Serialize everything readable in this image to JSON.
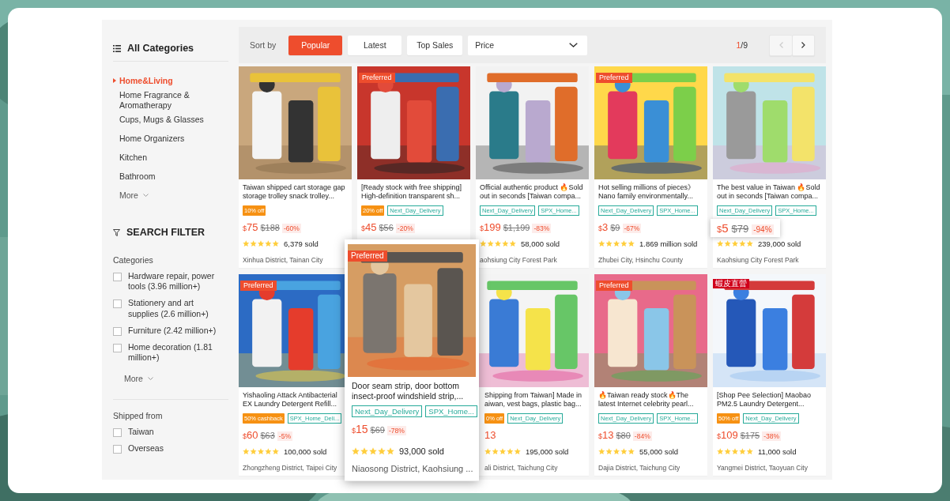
{
  "sidebar": {
    "title": "All Categories",
    "categories": [
      {
        "label": "Home&Living",
        "selected": true
      },
      {
        "label": "Home Fragrance & Aromatherapy",
        "selected": false
      },
      {
        "label": "Cups, Mugs & Glasses",
        "selected": false
      },
      {
        "label": "Home Organizers",
        "selected": false
      },
      {
        "label": "Kitchen",
        "selected": false
      },
      {
        "label": "Bathroom",
        "selected": false
      }
    ],
    "categories_more": "More",
    "filter_title": "SEARCH FILTER",
    "filter_groups": [
      {
        "title": "Categories",
        "options": [
          {
            "label": "Hardware repair, power tools (3.96 million+)",
            "checked": false
          },
          {
            "label": "Stationery and art supplies (2.6 million+)",
            "checked": false
          },
          {
            "label": "Furniture (2.42 million+)",
            "checked": false
          },
          {
            "label": "Home decoration (1.81 million+)",
            "checked": false
          }
        ],
        "more": "More"
      },
      {
        "title": "Shipped from",
        "options": [
          {
            "label": "Taiwan",
            "checked": false
          },
          {
            "label": "Overseas",
            "checked": false
          }
        ]
      }
    ]
  },
  "sort_bar": {
    "label": "Sort by",
    "options": [
      {
        "label": "Popular",
        "selected": true
      },
      {
        "label": "Latest",
        "selected": false
      },
      {
        "label": "Top Sales",
        "selected": false
      }
    ],
    "price_dropdown": "Price",
    "page_current": "1",
    "page_total": "/9",
    "prev_disabled": true
  },
  "products": [
    {
      "title": "Taiwan shipped cart storage gap storage trolley snack trolley...",
      "labels": [
        {
          "kind": "promo",
          "text": "10% off"
        }
      ],
      "price": {
        "currency": "$",
        "amount": "75",
        "original": "$188",
        "discount": "-60%"
      },
      "stars": 5,
      "sold": "6,379 sold",
      "location": "Xinhua District, Tainan City",
      "hovered": false,
      "price_raised": false
    },
    {
      "title": "[Ready stock with free shipping] High-definition transparent sh...",
      "badge": {
        "kind": "preferred",
        "text": "Preferred"
      },
      "labels": [
        {
          "kind": "promo",
          "text": "20% off"
        },
        {
          "kind": "tag",
          "text": "Next_Day_Delivery"
        }
      ],
      "price": {
        "currency": "$",
        "amount": "45",
        "original": "$56",
        "discount": "-20%"
      },
      "hovered": false,
      "price_raised": false
    },
    {
      "title": "Official authentic product 🔥Sold out in seconds [Taiwan compa...",
      "labels": [
        {
          "kind": "tag",
          "text": "Next_Day_Delivery"
        },
        {
          "kind": "tag",
          "text": "SPX_Home..."
        }
      ],
      "price": {
        "currency": "$",
        "amount": "199",
        "original": "$1,199",
        "discount": "-83%"
      },
      "stars": 5,
      "sold": "58,000 sold",
      "location": "aohsiung City Forest Park",
      "hovered": false,
      "price_raised": false
    },
    {
      "title": "Hot selling millions of pieces》 Nano family environmentally...",
      "badge": {
        "kind": "preferred",
        "text": "Preferred"
      },
      "labels": [
        {
          "kind": "tag",
          "text": "Next_Day_Delivery"
        },
        {
          "kind": "tag",
          "text": "SPX_Home..."
        }
      ],
      "price": {
        "currency": "$",
        "amount": "3",
        "original": "$9",
        "discount": "-67%"
      },
      "stars": 5,
      "sold": "1.869 million sold",
      "location": "Zhubei City, Hsinchu County",
      "hovered": false,
      "price_raised": false
    },
    {
      "title": "The best value in Taiwan 🔥Sold out in seconds [Taiwan compa...",
      "labels": [
        {
          "kind": "tag",
          "text": "Next_Day_Delivery"
        },
        {
          "kind": "tag",
          "text": "SPX_Home..."
        }
      ],
      "price": {
        "currency": "$",
        "amount": "5",
        "original": "$79",
        "discount": "-94%"
      },
      "stars": 5,
      "sold": "239,000 sold",
      "location": "Kaohsiung City Forest Park",
      "hovered": false,
      "price_raised": true
    },
    {
      "title": "Yishaoling Attack Antibacterial EX Laundry Detergent Refill...",
      "badge": {
        "kind": "preferred",
        "text": "Preferred"
      },
      "labels": [
        {
          "kind": "promo",
          "text": "50% cashback"
        },
        {
          "kind": "tag",
          "text": "SPX_Home_Deli..."
        }
      ],
      "price": {
        "currency": "$",
        "amount": "60",
        "original": "$63",
        "discount": "-5%"
      },
      "stars": 5,
      "sold": "100,000 sold",
      "location": "Zhongzheng District, Taipei City",
      "hovered": false,
      "price_raised": false
    },
    {
      "title": "Door seam strip, door bottom insect-proof windshield strip,...",
      "badge": {
        "kind": "preferred",
        "text": "Preferred"
      },
      "labels": [
        {
          "kind": "tag",
          "text": "Next_Day_Delivery"
        },
        {
          "kind": "tag",
          "text": "SPX_Home..."
        }
      ],
      "price": {
        "currency": "$",
        "amount": "15",
        "original": "$69",
        "discount": "-78%"
      },
      "stars": 5,
      "sold": "93,000 sold",
      "location": "Niaosong District, Kaohsiung ...",
      "hovered": true,
      "price_raised": false
    },
    {
      "title": "Shipping from Taiwan] Made in aiwan, vest bags, plastic bag...",
      "labels": [
        {
          "kind": "promo",
          "text": "0% off"
        },
        {
          "kind": "tag",
          "text": "Next_Day_Delivery"
        }
      ],
      "price": {
        "amount": "13"
      },
      "stars": 5,
      "sold": "195,000 sold",
      "location": "ali District, Taichung City",
      "hovered": false,
      "price_raised": false
    },
    {
      "title": "🔥Taiwan ready stock🔥The latest Internet celebrity pearl...",
      "badge": {
        "kind": "preferred",
        "text": "Preferred"
      },
      "labels": [
        {
          "kind": "tag",
          "text": "Next_Day_Delivery"
        },
        {
          "kind": "tag",
          "text": "SPX_Home..."
        }
      ],
      "price": {
        "currency": "$",
        "amount": "13",
        "original": "$80",
        "discount": "-84%"
      },
      "stars": 5,
      "sold": "55,000 sold",
      "location": "Dajia District, Taichung City",
      "hovered": false,
      "price_raised": false
    },
    {
      "title": "[Shop Pee Selection] Maobao PM2.5 Laundry Detergent...",
      "badge": {
        "kind": "mall",
        "text": "蝦皮直營"
      },
      "labels": [
        {
          "kind": "promo",
          "text": "50% off"
        },
        {
          "kind": "tag",
          "text": "Next_Day_Delivery"
        }
      ],
      "price": {
        "currency": "$",
        "amount": "109",
        "original": "$175",
        "discount": "-38%"
      },
      "stars": 5,
      "sold": "11,000 sold",
      "location": "Yangmei District, Taoyuan City",
      "hovered": false,
      "price_raised": false
    }
  ]
}
